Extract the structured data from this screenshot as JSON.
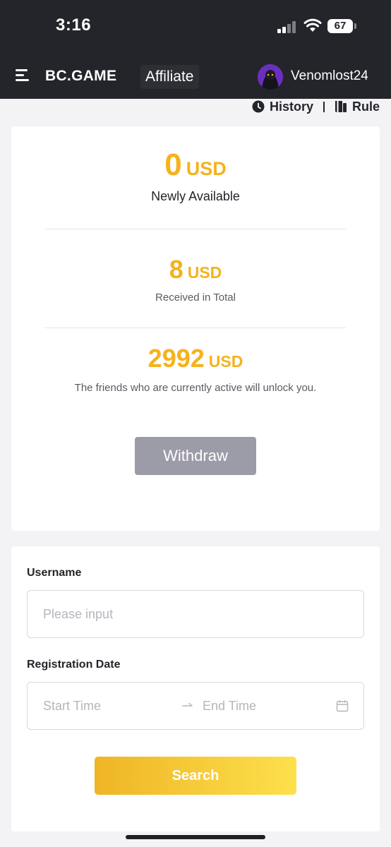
{
  "status_bar": {
    "time": "3:16",
    "battery": "67"
  },
  "navbar": {
    "brand": "BC.GAME",
    "section": "Affiliate",
    "username": "Venomlost24"
  },
  "top_links": {
    "history": "History",
    "rule": "Rule"
  },
  "summary": {
    "newly_available": {
      "amount": "0",
      "currency": "USD",
      "label": "Newly Available"
    },
    "received_total": {
      "amount": "8",
      "currency": "USD",
      "label": "Received in Total"
    },
    "locked": {
      "amount": "2992",
      "currency": "USD",
      "label": "The friends who are currently active will unlock you."
    },
    "withdraw_label": "Withdraw"
  },
  "filter": {
    "username_label": "Username",
    "username_placeholder": "Please input",
    "date_label": "Registration Date",
    "start_placeholder": "Start Time",
    "end_placeholder": "End Time",
    "search_label": "Search"
  },
  "colors": {
    "accent": "#f5b21c",
    "header_bg": "#24252a",
    "button_disabled": "#9c9ba8",
    "search_gradient_start": "#efb526",
    "search_gradient_end": "#fde04c"
  }
}
